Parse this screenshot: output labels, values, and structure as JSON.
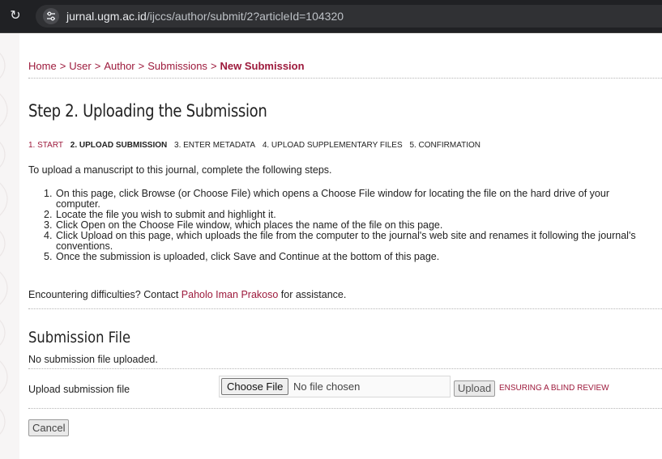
{
  "browser": {
    "url_host": "jurnal.ugm.ac.id",
    "url_path": "/ijccs/author/submit/2?articleId=104320"
  },
  "breadcrumb": {
    "items": [
      "Home",
      "User",
      "Author",
      "Submissions"
    ],
    "separator": ">",
    "current": "New Submission"
  },
  "page": {
    "title": "Step 2. Uploading the Submission"
  },
  "steps": [
    {
      "label": "1. Start",
      "state": "link"
    },
    {
      "label": "2. Upload Submission",
      "state": "active"
    },
    {
      "label": "3. Enter Metadata",
      "state": "inactive"
    },
    {
      "label": "4. Upload Supplementary Files",
      "state": "inactive"
    },
    {
      "label": "5. Confirmation",
      "state": "inactive"
    }
  ],
  "intro": "To upload a manuscript to this journal, complete the following steps.",
  "instructions": [
    {
      "num": "1.",
      "lines": [
        "On this page, click Browse (or Choose File) which opens a Choose File window for locating the file on the hard drive of your",
        "computer."
      ]
    },
    {
      "num": "2.",
      "lines": [
        "Locate the file you wish to submit and highlight it."
      ]
    },
    {
      "num": "3.",
      "lines": [
        "Click Open on the Choose File window, which places the name of the file on this page."
      ]
    },
    {
      "num": "4.",
      "lines": [
        "Click Upload on this page, which uploads the file from the computer to the journal's web site and renames it following the journal's",
        "conventions."
      ]
    },
    {
      "num": "5.",
      "lines": [
        "Once the submission is uploaded, click Save and Continue at the bottom of this page."
      ]
    }
  ],
  "contact": {
    "prefix": "Encountering difficulties? Contact ",
    "name": "Paholo Iman Prakoso",
    "suffix": " for assistance."
  },
  "submission_file": {
    "title": "Submission File",
    "status": "No submission file uploaded.",
    "upload_label": "Upload submission file",
    "choose_label": "Choose File",
    "file_status": "No file chosen",
    "upload_button": "Upload",
    "blind_review_link": "Ensuring a Blind Review"
  },
  "actions": {
    "cancel": "Cancel"
  },
  "colors": {
    "accent": "#9d1a3c",
    "chrome_bg": "#202124"
  },
  "icons": [
    "reload-icon",
    "site-info-icon"
  ]
}
